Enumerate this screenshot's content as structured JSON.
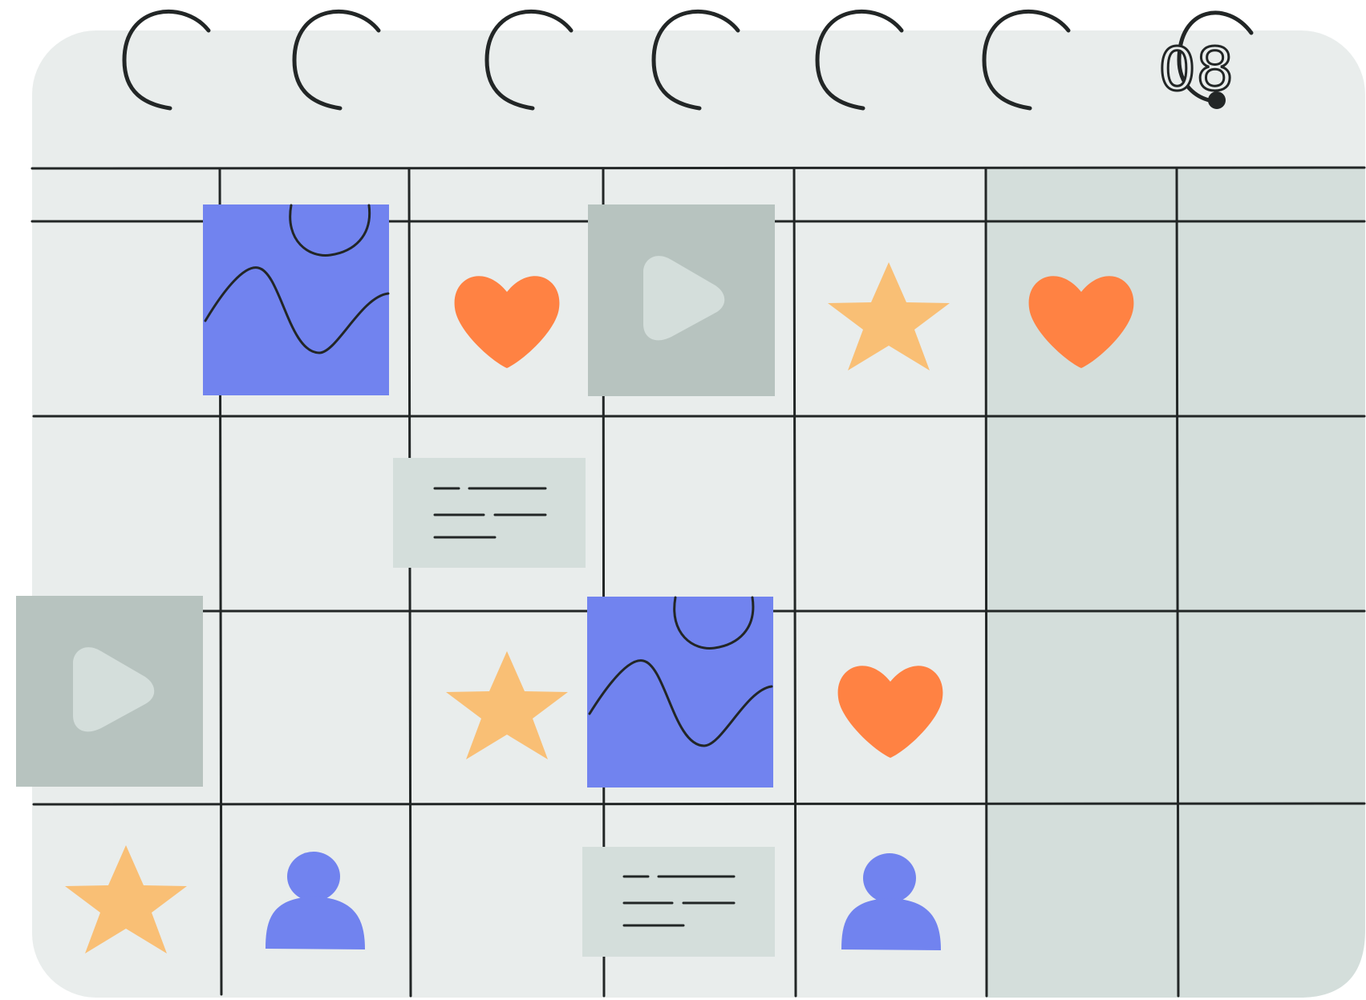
{
  "calendar": {
    "date_label": "08",
    "colors": {
      "paper": "#E9EDEC",
      "weekend": "#D4DEDB",
      "stroke": "#222626",
      "blue": "#7183EF",
      "orange": "#FF8243",
      "yellow": "#F9BF75",
      "video_bg": "#B7C3BF",
      "video_play": "#D4DEDB",
      "note_bg": "#D4DEDB"
    },
    "grid": {
      "columns": 7,
      "rows": 4,
      "weekend_columns": [
        6,
        7
      ]
    },
    "cells": [
      {
        "row": 1,
        "col": 2,
        "icon": "chart-wave-icon"
      },
      {
        "row": 1,
        "col": 3,
        "icon": "heart-icon"
      },
      {
        "row": 1,
        "col": 4,
        "icon": "video-play-icon"
      },
      {
        "row": 1,
        "col": 5,
        "icon": "star-icon"
      },
      {
        "row": 1,
        "col": 6,
        "icon": "heart-icon"
      },
      {
        "row": 2,
        "col": 3,
        "icon": "text-note-icon"
      },
      {
        "row": 3,
        "col": 1,
        "icon": "video-play-icon"
      },
      {
        "row": 3,
        "col": 3,
        "icon": "star-icon"
      },
      {
        "row": 3,
        "col": 4,
        "icon": "chart-wave-icon"
      },
      {
        "row": 3,
        "col": 5,
        "icon": "heart-icon"
      },
      {
        "row": 4,
        "col": 1,
        "icon": "star-icon"
      },
      {
        "row": 4,
        "col": 2,
        "icon": "user-icon"
      },
      {
        "row": 4,
        "col": 4,
        "icon": "text-note-icon"
      },
      {
        "row": 4,
        "col": 5,
        "icon": "user-icon"
      }
    ]
  }
}
